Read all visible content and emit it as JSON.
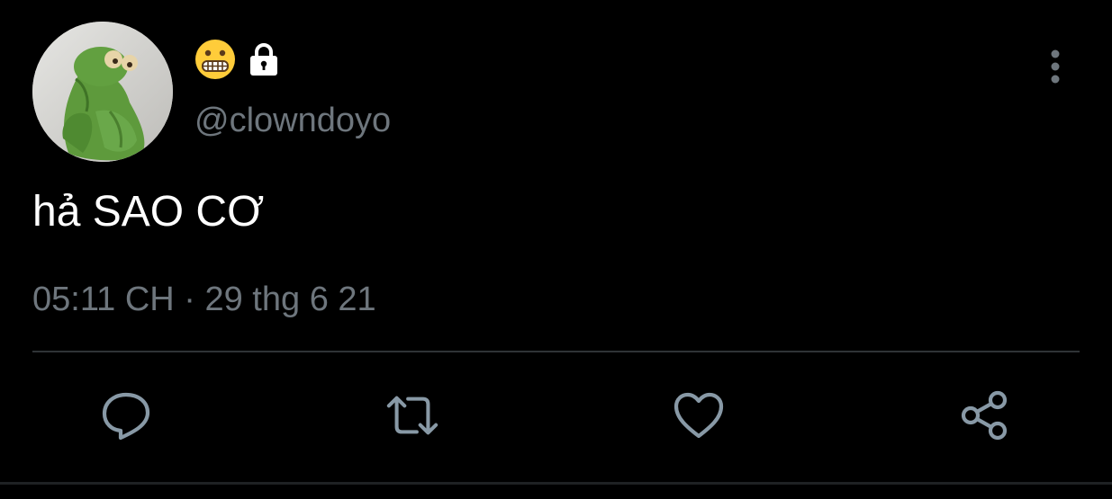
{
  "tweet": {
    "author": {
      "display_name_icons": [
        "grimacing-face-emoji",
        "lock-icon"
      ],
      "handle": "@clowndoyo",
      "avatar": "green-frog-plush-photo"
    },
    "text": "hả SAO CƠ",
    "timestamp": "05:11 CH · 29 thg 6 21",
    "actions": [
      "reply-icon",
      "retweet-icon",
      "like-icon",
      "share-icon"
    ],
    "menu_icon": "more-vertical-icon"
  },
  "colors": {
    "background": "#000000",
    "text": "#ffffff",
    "secondary_text": "#6e767d",
    "divider": "#2f3336",
    "action_icon": "#8899a6"
  }
}
